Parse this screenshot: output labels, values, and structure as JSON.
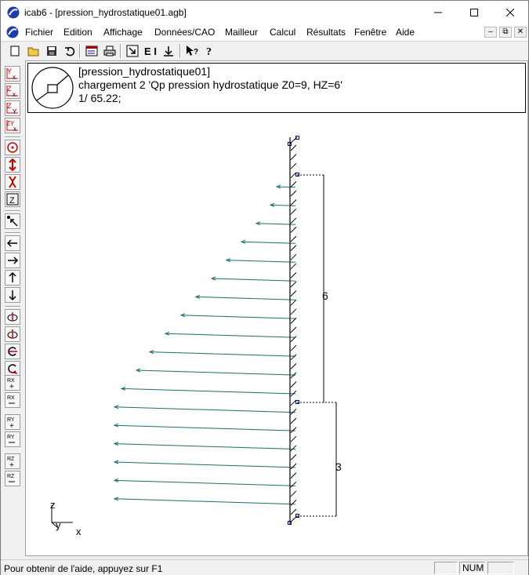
{
  "window": {
    "title": "icab6 - [pression_hydrostatique01.agb]",
    "controls": [
      "minimize",
      "maximize",
      "close"
    ]
  },
  "menubar": {
    "items": [
      "Fichier",
      "Edition",
      "Affichage",
      "Données/CAO",
      "Mailleur",
      "Calcul",
      "Résultats",
      "Fenêtre",
      "Aide"
    ]
  },
  "toolbar": {
    "icons": [
      "new-file-icon",
      "open-folder-icon",
      "save-icon",
      "undo-icon",
      "window-icon",
      "print-icon",
      "zoom-fit-icon",
      "text-edit-icon",
      "down-arrow-icon",
      "context-help-icon",
      "help-icon"
    ],
    "text_button_label": "E I"
  },
  "left_toolbar": {
    "buttons": [
      {
        "name": "view-yx",
        "label": "Y\nx"
      },
      {
        "name": "view-zx",
        "label": "Z\nx"
      },
      {
        "name": "view-zy",
        "label": "Z\nY"
      },
      {
        "name": "view-zyx",
        "label": "ZY\nx"
      },
      {
        "name": "target",
        "label": "⊙"
      },
      {
        "name": "up-down",
        "label": "↕"
      },
      {
        "name": "pinch",
        "label": "X"
      },
      {
        "name": "zoom-box",
        "label": "Z"
      },
      {
        "name": "pan-diagonal",
        "label": "↖"
      },
      {
        "name": "pan-left",
        "label": "←"
      },
      {
        "name": "pan-right",
        "label": "→"
      },
      {
        "name": "pan-up",
        "label": "↑"
      },
      {
        "name": "pan-down",
        "label": "↓"
      },
      {
        "name": "rotate-1",
        "label": "◐"
      },
      {
        "name": "rotate-2",
        "label": "◑"
      },
      {
        "name": "rotate-3",
        "label": "⟳"
      },
      {
        "name": "rotate-4",
        "label": "⟲"
      },
      {
        "name": "rx-plus",
        "label": "RX\n+"
      },
      {
        "name": "rx-minus",
        "label": "RX\n−"
      },
      {
        "name": "ry-plus",
        "label": "RY\n+"
      },
      {
        "name": "ry-minus",
        "label": "RY\n−"
      },
      {
        "name": "rz-plus",
        "label": "RZ\n+"
      },
      {
        "name": "rz-minus",
        "label": "RZ\n−"
      }
    ]
  },
  "header": {
    "file": "[pression_hydrostatique01]",
    "load_case": "chargement 2 'Qp pression hydrostatique Z0=9, HZ=6'",
    "scale": "1/ 65.22;"
  },
  "drawing": {
    "dim_upper": "6",
    "dim_lower": "3",
    "axis_z": "z",
    "axis_y": "y",
    "axis_x": "x",
    "arrow_color": "#1a6f6f",
    "beam_color": "#000000",
    "node_color": "#000080"
  },
  "statusbar": {
    "help_text": "Pour obtenir de l'aide, appuyez sur F1",
    "num_indicator": "NUM"
  }
}
